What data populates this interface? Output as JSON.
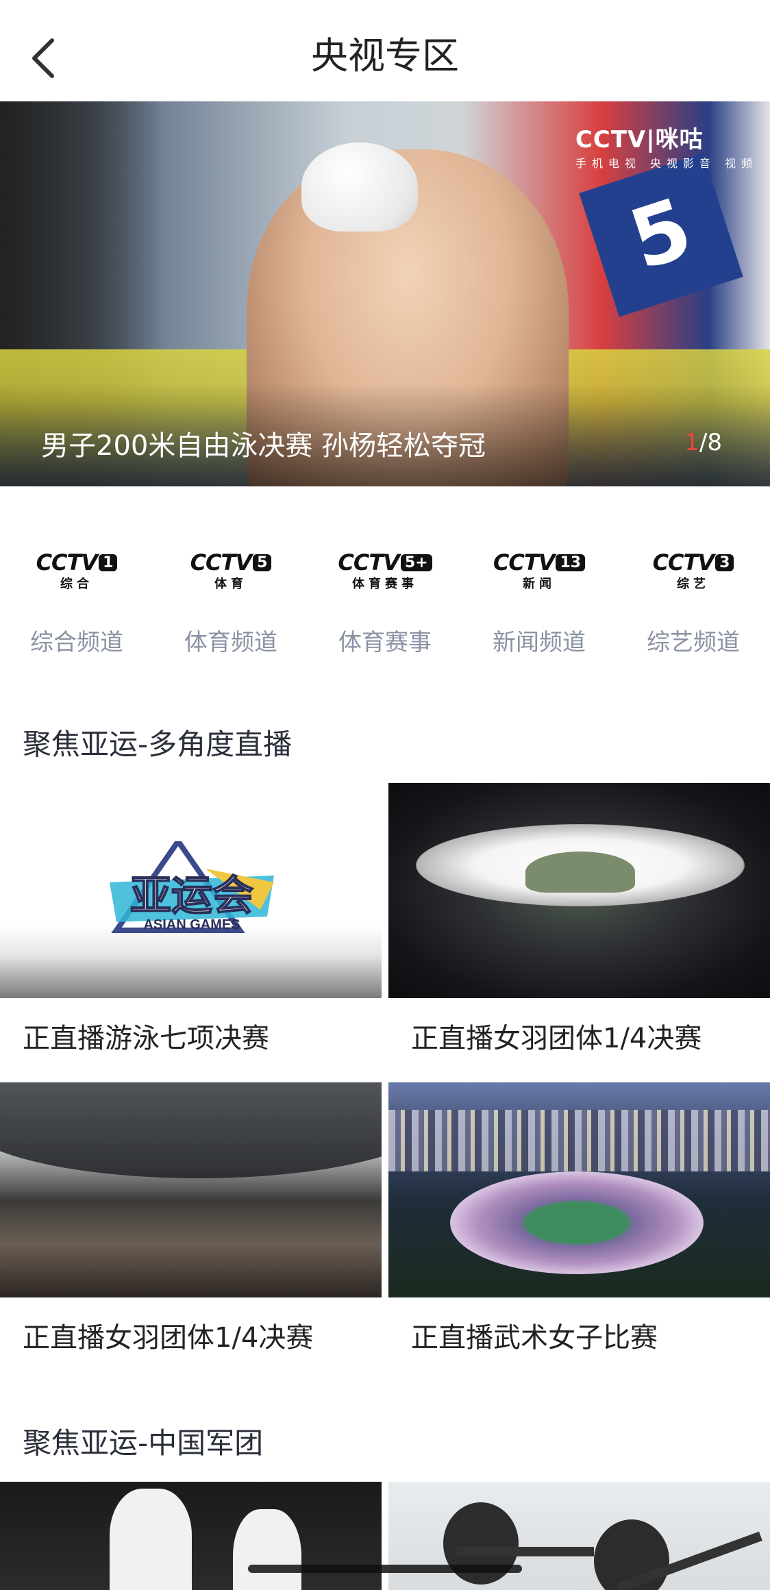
{
  "header": {
    "title": "央视专区",
    "back_icon": "chevron-left-icon"
  },
  "hero": {
    "caption": "男子200米自由泳决赛 孙杨轻松夺冠",
    "counter_current": "1",
    "counter_total": "/8",
    "watermark_main": "CCTV|咪咕",
    "watermark_sub": "手机电视 央视影音 视频",
    "accent": "#e8463c"
  },
  "channels": [
    {
      "logo": "CCTV",
      "num": "1",
      "logo_sub": "综合",
      "label": "综合频道"
    },
    {
      "logo": "CCTV",
      "num": "5",
      "logo_sub": "体育",
      "label": "体育频道"
    },
    {
      "logo": "CCTV",
      "num": "5+",
      "logo_sub": "体育赛事",
      "label": "体育赛事"
    },
    {
      "logo": "CCTV",
      "num": "13",
      "logo_sub": "新闻",
      "label": "新闻频道"
    },
    {
      "logo": "CCTV",
      "num": "3",
      "logo_sub": "综艺",
      "label": "综艺频道"
    }
  ],
  "sections": [
    {
      "title": "聚焦亚运-多角度直播",
      "items": [
        {
          "name": "正直播游泳七项决赛",
          "badge_text": "ASIAN GAMES"
        },
        {
          "name": "正直播女羽团体1/4决赛"
        },
        {
          "name": "正直播女羽团体1/4决赛"
        },
        {
          "name": "正直播武术女子比赛"
        }
      ]
    },
    {
      "title": "聚焦亚运-中国军团",
      "items": [
        {
          "name": ""
        },
        {
          "name": ""
        }
      ]
    }
  ]
}
